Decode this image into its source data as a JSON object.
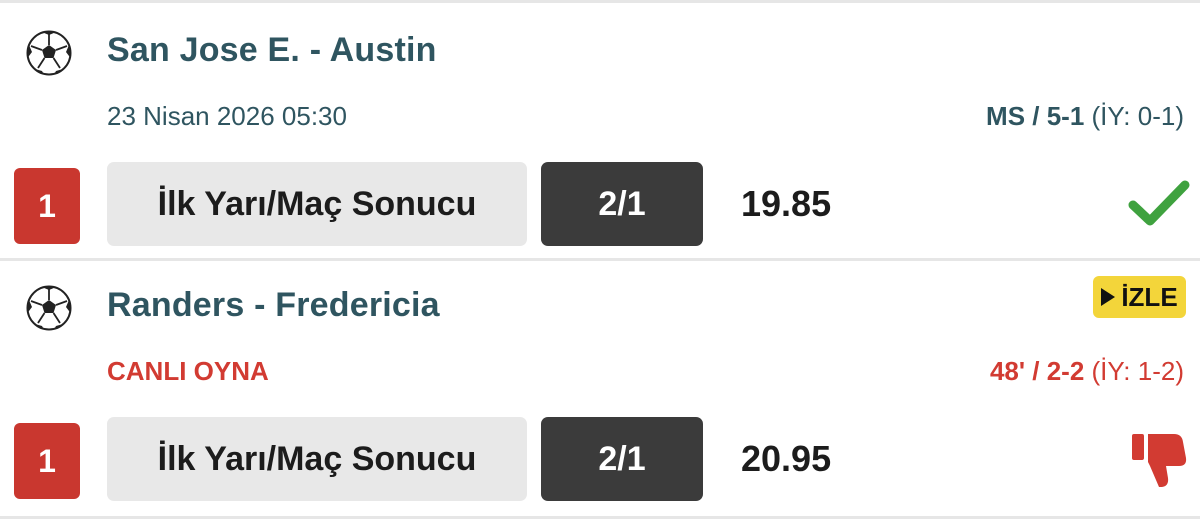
{
  "colors": {
    "team_text": "#2f5560",
    "live_red": "#d23b32",
    "badge_red": "#c9372f",
    "market_bg": "#e8e8e8",
    "pick_bg": "#3b3b3b",
    "win_green": "#3fa23f",
    "watch_yellow": "#f3d53a"
  },
  "matches": [
    {
      "sport_icon": "soccer-ball-icon",
      "teams": "San Jose E. - Austin",
      "date": "23 Nisan 2026 05:30",
      "status_main": "MS / 5-1",
      "status_ht": " (İY: 0-1)",
      "number": "1",
      "market": "İlk Yarı/Maç Sonucu",
      "pick": "2/1",
      "odds": "19.85",
      "result_icon": "check-icon"
    },
    {
      "sport_icon": "soccer-ball-icon",
      "teams": "Randers - Fredericia",
      "live_label": "CANLI OYNA",
      "watch_label": "İZLE",
      "status_main": "48' / 2-2",
      "status_ht": " (İY: 1-2)",
      "number": "1",
      "market": "İlk Yarı/Maç Sonucu",
      "pick": "2/1",
      "odds": "20.95",
      "result_icon": "thumbs-down-icon"
    }
  ]
}
